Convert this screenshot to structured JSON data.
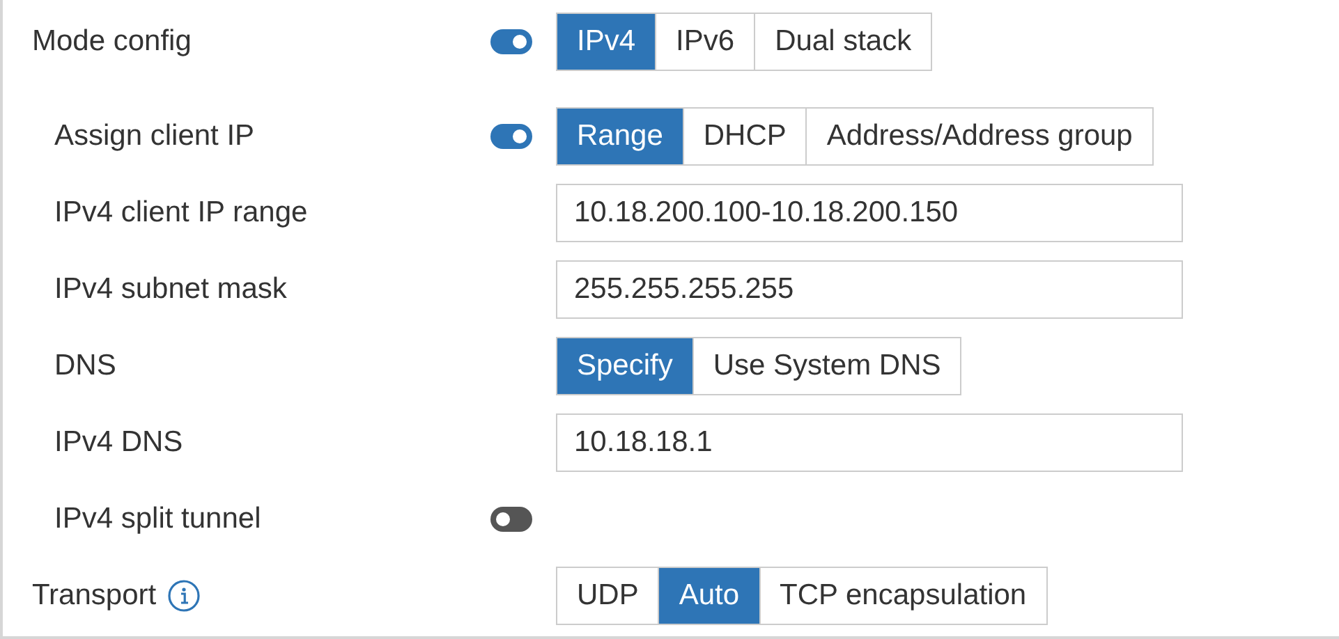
{
  "rows": [
    {
      "kind": "toggle_segment",
      "label": "Mode config",
      "on": true,
      "options": [
        {
          "label": "IPv4",
          "selected": true
        },
        {
          "label": "IPv6",
          "selected": false
        },
        {
          "label": "Dual stack",
          "selected": false
        }
      ],
      "children": [
        {
          "kind": "toggle_segment",
          "label": "Assign client IP",
          "on": true,
          "options": [
            {
              "label": "Range",
              "selected": true
            },
            {
              "label": "DHCP",
              "selected": false
            },
            {
              "label": "Address/Address group",
              "selected": false
            }
          ]
        },
        {
          "kind": "input",
          "label": "IPv4 client IP range",
          "value": "10.18.200.100-10.18.200.150"
        },
        {
          "kind": "input",
          "label": "IPv4 subnet mask",
          "value": "255.255.255.255"
        },
        {
          "kind": "segment",
          "label": "DNS",
          "options": [
            {
              "label": "Specify",
              "selected": true
            },
            {
              "label": "Use System DNS",
              "selected": false
            }
          ]
        },
        {
          "kind": "input",
          "label": "IPv4 DNS",
          "value": "10.18.18.1"
        },
        {
          "kind": "toggle",
          "label": "IPv4 split tunnel",
          "on": false
        }
      ]
    },
    {
      "kind": "segment",
      "label": "Transport",
      "info": true,
      "options": [
        {
          "label": "UDP",
          "selected": false
        },
        {
          "label": "Auto",
          "selected": true
        },
        {
          "label": "TCP encapsulation",
          "selected": false
        }
      ]
    }
  ]
}
